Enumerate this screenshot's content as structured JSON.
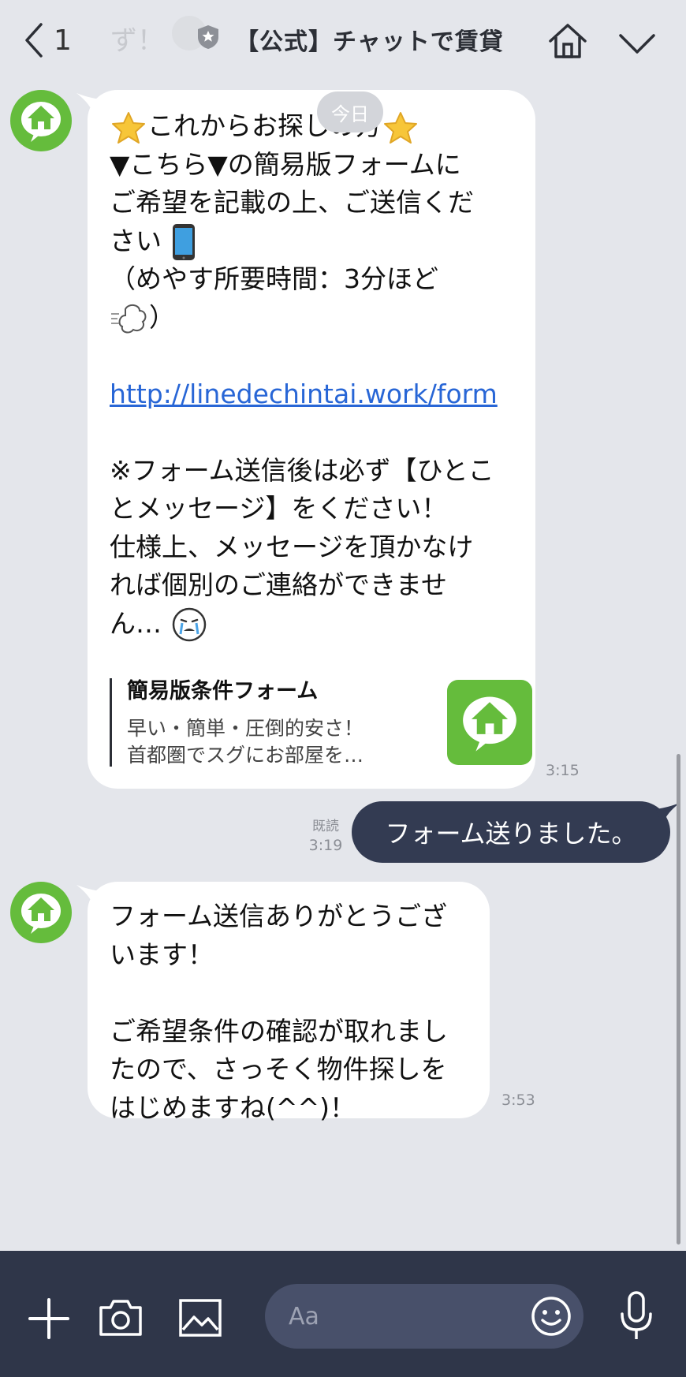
{
  "header": {
    "back_count": "1",
    "ghost_text": "ず！",
    "title": "【公式】チャットで賃貸"
  },
  "date_label": "今日",
  "messages": [
    {
      "lines": [
        "これからお探しの方",
        "▼こちら▼の簡易版フォームに",
        "ご希望を記載の上、ご送信くだ",
        "さい",
        "（めやす所要時間：3分ほど",
        "）",
        "",
        "http://linedechintai.work/form",
        "",
        "※フォーム送信後は必ず【ひとこ",
        "とメッセージ】をください！",
        "仕様上、メッセージを頂かなけ",
        "れば個別のご連絡ができませ",
        "ん…"
      ],
      "preview": {
        "title": "簡易版条件フォーム",
        "line1": "早い・簡単・圧倒的安さ！",
        "line2": "首都圏でスグにお部屋を…"
      },
      "time": "3:15"
    },
    {
      "text": "フォーム送りました。",
      "read": "既読",
      "time": "3:19"
    },
    {
      "lines": [
        "フォーム送信ありがとうござ",
        "います！",
        "",
        "ご希望条件の確認が取れまし",
        "たので、さっそく物件探しを",
        "はじめますね(^^)！"
      ],
      "time": "3:53"
    }
  ],
  "input": {
    "placeholder": "Aa"
  },
  "colors": {
    "background": "#e4e6eb",
    "brand_green": "#65bc3c",
    "sent_bubble": "#333b52",
    "bottom_bar": "#2f3649",
    "link": "#2866d6"
  },
  "icons": [
    "back-chevron-icon",
    "official-badge-icon",
    "home-icon",
    "chevron-down-icon",
    "plus-icon",
    "camera-icon",
    "image-icon",
    "emoji-icon",
    "microphone-icon",
    "star-emoji-icon",
    "smartphone-emoji-icon",
    "dash-emoji-icon",
    "crying-emoji-icon"
  ]
}
